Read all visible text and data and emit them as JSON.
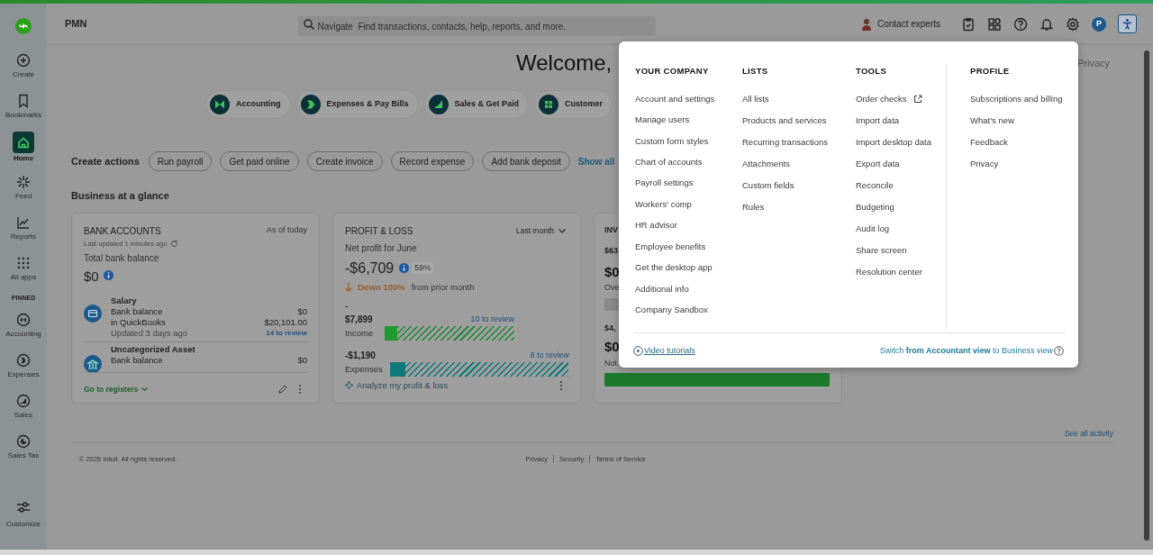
{
  "sidebar": {
    "items": [
      {
        "label": "Create",
        "selected": false
      },
      {
        "label": "Bookmarks",
        "selected": false
      },
      {
        "label": "Home",
        "selected": true
      },
      {
        "label": "Feed",
        "selected": false
      },
      {
        "label": "Reports",
        "selected": false
      },
      {
        "label": "All apps",
        "selected": false
      }
    ],
    "pinned_label": "PINNED",
    "pinned": [
      {
        "label": "Accounting",
        "selected": false
      },
      {
        "label": "Expenses",
        "selected": false
      },
      {
        "label": "Sales",
        "selected": false
      },
      {
        "label": "Sales Tax",
        "selected": false
      }
    ],
    "customize": "Customize"
  },
  "topbar": {
    "company": "PMN",
    "search": {
      "placeholder": "Navigate  Find transactions, contacts, help, reports, and more."
    },
    "contact_experts": "Contact experts",
    "avatar": "P"
  },
  "header": {
    "welcome": "Welcome,",
    "privacy": "Privacy"
  },
  "chips": [
    "Accounting",
    "Expenses & Pay Bills",
    "Sales & Get Paid",
    "Customer"
  ],
  "create_actions": {
    "label": "Create actions",
    "buttons": [
      "Run payroll",
      "Get paid online",
      "Create invoice",
      "Record expense",
      "Add bank deposit"
    ],
    "show_all": "Show all"
  },
  "section_title": "Business at a glance",
  "bank_card": {
    "title": "BANK ACCOUNTS",
    "as_of": "As of today",
    "last_updated": "Last updated 1 minutes ago",
    "total_label": "Total bank balance",
    "total": "$0",
    "accounts": [
      {
        "name": "Salary",
        "lines": [
          [
            "Bank balance",
            "$0"
          ],
          [
            "in QuickBooks",
            "$20,101.00"
          ],
          [
            "Updated 3 days ago",
            "14 to review"
          ]
        ]
      },
      {
        "name": "Uncategorized Asset",
        "lines": [
          [
            "Bank balance",
            "$0"
          ]
        ]
      }
    ],
    "go_to_registers": "Go to registers"
  },
  "pl_card": {
    "title": "PROFIT & LOSS",
    "period": "Last month",
    "subtitle": "Net profit for June",
    "net": "-$6,709",
    "percent": "59%",
    "change": "Down 100%",
    "change_suffix": "from prior month",
    "dash": "-",
    "bars": [
      {
        "amount": "$7,899",
        "review": "10 to review",
        "label": "Income",
        "level": 0.1
      },
      {
        "amount": "-$1,190",
        "review": "8 to review",
        "label": "Expenses",
        "level": 0.085
      }
    ],
    "analyze": "Analyze my profit & loss"
  },
  "third_card": {
    "title": "INV",
    "line_1": "$63",
    "amount_1": "$0",
    "line_2": "Ove",
    "line_3": "$4,",
    "amount_2": "$0",
    "line_4": "Not",
    "bars": [
      {
        "level": 0
      },
      {
        "level": 1
      }
    ]
  },
  "see_all": "See all activity",
  "footer": {
    "copyright": "© 2026 Intuit. All rights reserved.",
    "links": [
      "Privacy",
      "Security",
      "Terms of Service"
    ]
  },
  "menu": {
    "columns": [
      {
        "heading": "YOUR COMPANY",
        "items": [
          {
            "label": "Account and settings"
          },
          {
            "label": "Manage users"
          },
          {
            "label": "Custom form styles"
          },
          {
            "label": "Chart of accounts"
          },
          {
            "label": "Payroll settings"
          },
          {
            "label": "Workers' comp"
          },
          {
            "label": "HR advisor"
          },
          {
            "label": "Employee benefits"
          },
          {
            "label": "Get the desktop app"
          },
          {
            "label": "Additional info"
          },
          {
            "label": "Company Sandbox"
          }
        ]
      },
      {
        "heading": "LISTS",
        "items": [
          {
            "label": "All lists"
          },
          {
            "label": "Products and services"
          },
          {
            "label": "Recurring transactions"
          },
          {
            "label": "Attachments"
          },
          {
            "label": "Custom fields"
          },
          {
            "label": "Rules"
          }
        ]
      },
      {
        "heading": "TOOLS",
        "items": [
          {
            "label": "Order checks",
            "external": true
          },
          {
            "label": "Import data"
          },
          {
            "label": "Import desktop data"
          },
          {
            "label": "Export data"
          },
          {
            "label": "Reconcile"
          },
          {
            "label": "Budgeting"
          },
          {
            "label": "Audit log"
          },
          {
            "label": "Share screen"
          },
          {
            "label": "Resolution center"
          }
        ]
      },
      {
        "heading": "PROFILE",
        "items": [
          {
            "label": "Subscriptions and billing"
          },
          {
            "label": "What's new"
          },
          {
            "label": "Feedback"
          },
          {
            "label": "Privacy"
          }
        ]
      }
    ],
    "video_tutorials": "Video tutorials",
    "switch_view": "Switch **from Accountant view** to Business view"
  }
}
